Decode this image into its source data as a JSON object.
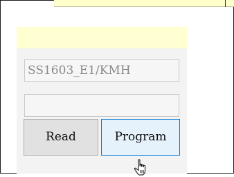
{
  "device_field": {
    "value": "SS1603_E1/KMH",
    "placeholder": ""
  },
  "secondary_field": {
    "value": ""
  },
  "buttons": {
    "read_label": "Read",
    "program_label": "Program"
  },
  "colors": {
    "highlight_yellow": "#ffffd2",
    "panel_bg": "#f3f3f3",
    "button_hover_border": "#0078d7",
    "button_hover_bg": "#e5f1fb"
  },
  "icons": {
    "cursor": "hand-pointer-icon"
  }
}
